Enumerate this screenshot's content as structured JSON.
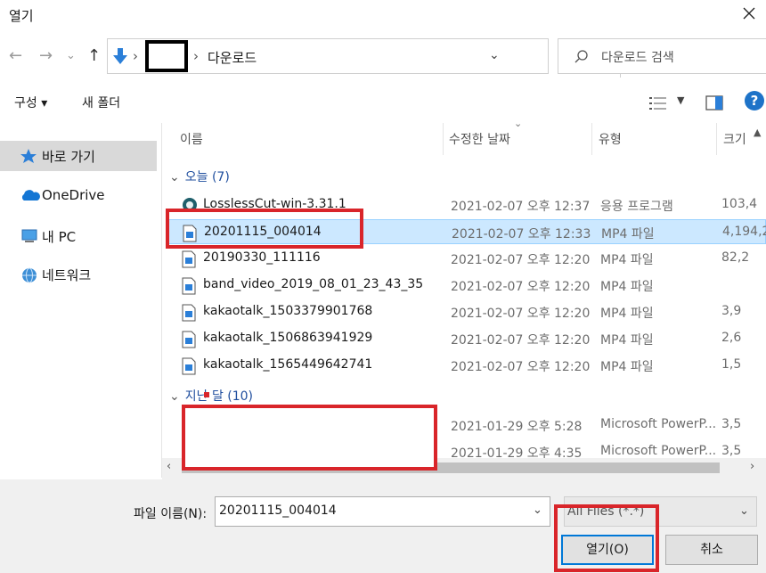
{
  "window": {
    "title": "열기"
  },
  "address": {
    "current_folder": "다운로드",
    "search_placeholder": "다운로드 검색"
  },
  "toolbar": {
    "organize": "구성 ▾",
    "new_folder": "새 폴더",
    "help": "?"
  },
  "nav": {
    "items": [
      {
        "label": "바로 가기",
        "icon": "star-icon"
      },
      {
        "label": "OneDrive",
        "icon": "cloud-icon"
      },
      {
        "label": "내 PC",
        "icon": "computer-icon"
      },
      {
        "label": "네트워크",
        "icon": "network-icon"
      }
    ]
  },
  "list": {
    "headers": {
      "name": "이름",
      "date": "수정한 날짜",
      "type": "유형",
      "size": "크기"
    },
    "groups": [
      {
        "label": "오늘 (7)"
      },
      {
        "label": "지난 달 (10)"
      }
    ],
    "today_rows": [
      {
        "name": "LosslessCut-win-3.31.1",
        "date": "2021-02-07 오후 12:37",
        "type": "응용 프로그램",
        "size": "103,4",
        "icon": "app-icon"
      },
      {
        "name": "20201115_004014",
        "date": "2021-02-07 오후 12:33",
        "type": "MP4 파일",
        "size": "4,194,2",
        "icon": "video-file-icon"
      },
      {
        "name": "20190330_111116",
        "date": "2021-02-07 오후 12:20",
        "type": "MP4 파일",
        "size": "82,2",
        "icon": "video-file-icon"
      },
      {
        "name": "band_video_2019_08_01_23_43_35",
        "date": "2021-02-07 오후 12:20",
        "type": "MP4 파일",
        "size": "",
        "icon": "video-file-icon"
      },
      {
        "name": "kakaotalk_1503379901768",
        "date": "2021-02-07 오후 12:20",
        "type": "MP4 파일",
        "size": "3,9",
        "icon": "video-file-icon"
      },
      {
        "name": "kakaotalk_1506863941929",
        "date": "2021-02-07 오후 12:20",
        "type": "MP4 파일",
        "size": "2,6",
        "icon": "video-file-icon"
      },
      {
        "name": "kakaotalk_1565449642741",
        "date": "2021-02-07 오후 12:20",
        "type": "MP4 파일",
        "size": "1,5",
        "icon": "video-file-icon"
      }
    ],
    "last_month_rows": [
      {
        "name": "",
        "date": "2021-01-29 오후 5:28",
        "type": "Microsoft PowerP...",
        "size": "3,5"
      },
      {
        "name": "",
        "date": "2021-01-29 오후 4:35",
        "type": "Microsoft PowerP...",
        "size": "3,5"
      }
    ]
  },
  "footer": {
    "filename_label": "파일 이름(N):",
    "filename_value": "20201115_004014",
    "filter_value": "All Files (*.*)",
    "open_button": "열기(O)",
    "cancel_button": "취소"
  },
  "colors": {
    "accent": "#0078d7",
    "selection": "#cce8ff",
    "annotation_red": "#d9252a",
    "group_blue": "#1f4e9e"
  }
}
